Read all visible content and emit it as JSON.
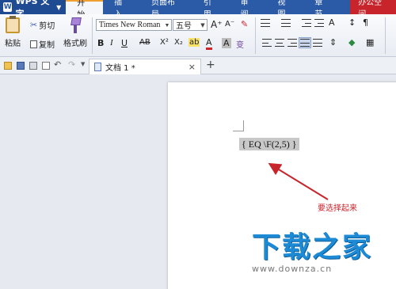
{
  "app": {
    "name": "WPS 文字"
  },
  "menu": {
    "tabs": [
      "开始",
      "插入",
      "页面布局",
      "引用",
      "审阅",
      "视图",
      "章节",
      "办公空间"
    ],
    "active": "开始"
  },
  "ribbon": {
    "paste_label": "粘贴",
    "cut_label": "剪切",
    "copy_label": "复制",
    "format_painter_label": "格式刷",
    "font_name": "Times New Roman",
    "font_size": "五号",
    "bold": "B",
    "italic": "I",
    "underline": "U",
    "strikethrough": "AB",
    "superscript": "X²",
    "subscript": "X₂",
    "grow_font": "A⁺",
    "shrink_font": "A⁻",
    "font_color": "A",
    "char_shading": "A",
    "phonetic": "变",
    "highlight": "ab",
    "text_direction": "A"
  },
  "tabs": {
    "document_title": "文档 1 *",
    "close": "×",
    "new": "+"
  },
  "document": {
    "field_code": "{ EQ \\F(2,5) }",
    "annotation": "要选择起来"
  },
  "watermark": {
    "title": "下载之家",
    "url": "www.downza.cn"
  },
  "colors": {
    "menubar": "#2b5aa6",
    "annotation": "#c8242b",
    "watermark": "#1d8ad6"
  }
}
